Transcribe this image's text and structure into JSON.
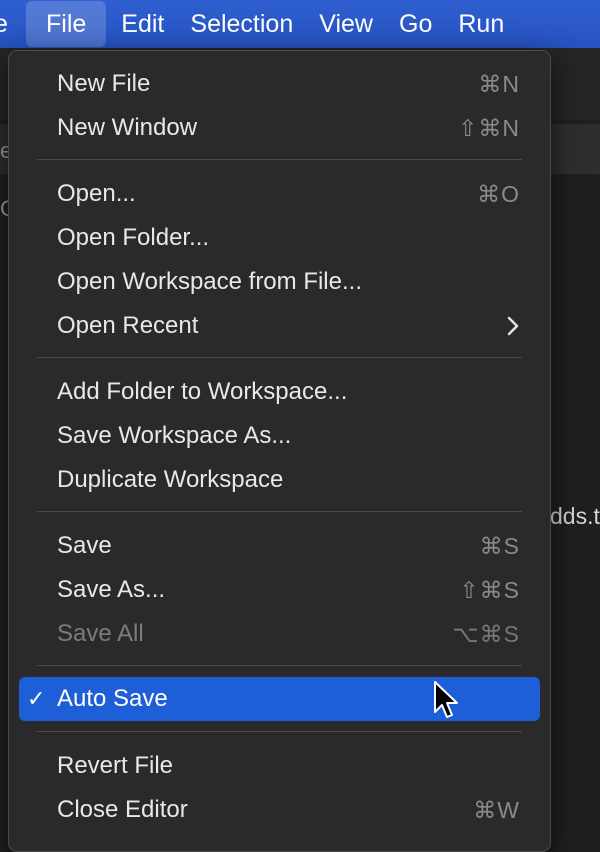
{
  "menubar": {
    "items": [
      {
        "label": "e"
      },
      {
        "label": "File"
      },
      {
        "label": "Edit"
      },
      {
        "label": "Selection"
      },
      {
        "label": "View"
      },
      {
        "label": "Go"
      },
      {
        "label": "Run"
      }
    ]
  },
  "background": {
    "edge_text_1": "e",
    "edge_text_2": "C",
    "partial_filename": "dds.t"
  },
  "file_menu": {
    "items": [
      {
        "label": "New File",
        "shortcut": "⌘N"
      },
      {
        "label": "New Window",
        "shortcut": "⇧⌘N"
      },
      {
        "label": "Open...",
        "shortcut": "⌘O"
      },
      {
        "label": "Open Folder..."
      },
      {
        "label": "Open Workspace from File..."
      },
      {
        "label": "Open Recent"
      },
      {
        "label": "Add Folder to Workspace..."
      },
      {
        "label": "Save Workspace As..."
      },
      {
        "label": "Duplicate Workspace"
      },
      {
        "label": "Save",
        "shortcut": "⌘S"
      },
      {
        "label": "Save As...",
        "shortcut": "⇧⌘S"
      },
      {
        "label": "Save All",
        "shortcut": "⌥⌘S"
      },
      {
        "label": "Auto Save",
        "check": "✓"
      },
      {
        "label": "Revert File"
      },
      {
        "label": "Close Editor",
        "shortcut": "⌘W"
      }
    ]
  },
  "colors": {
    "menubar": "#2653c2",
    "selection": "#1e5ed6",
    "menu_bg": "#2a2a2c"
  }
}
